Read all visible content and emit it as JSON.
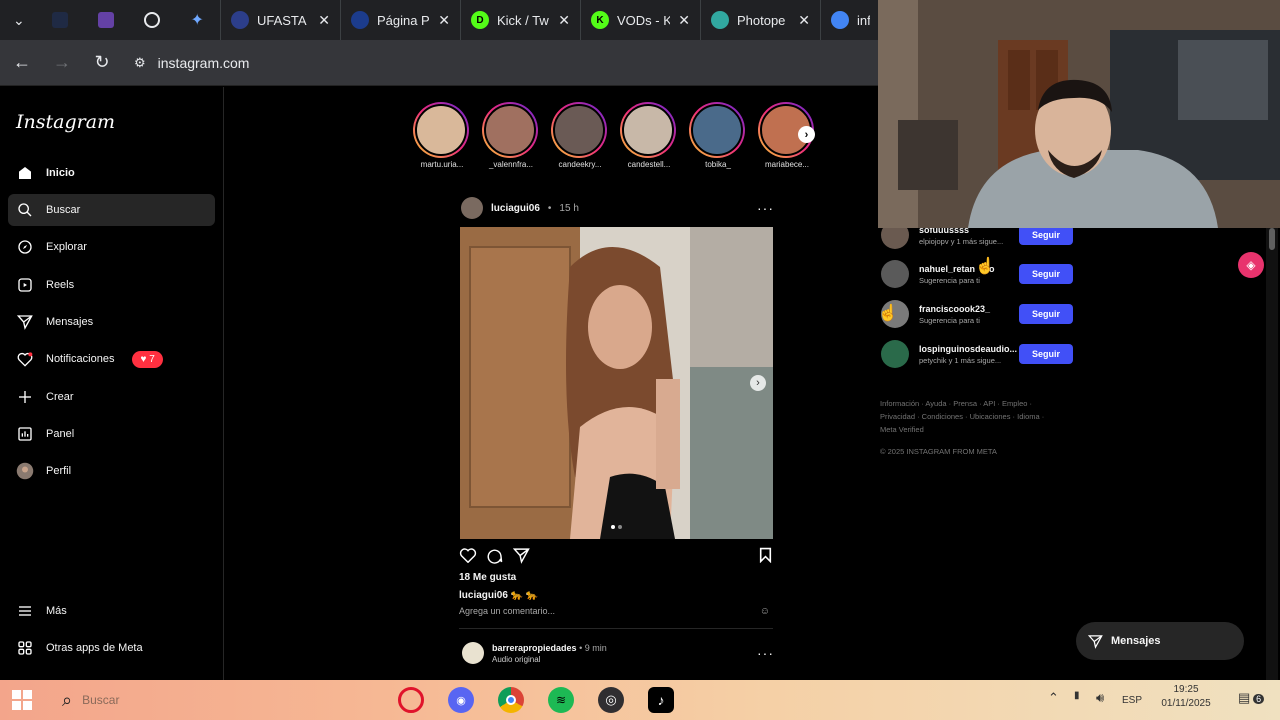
{
  "browser": {
    "tabs": [
      {
        "title": "UFASTA I",
        "fav_color": "#2c3e8a"
      },
      {
        "title": "Página Pr",
        "fav_color": "#1c3c8c"
      },
      {
        "title": "Kick / Tw",
        "fav_color": "#53fc18",
        "fav_letter": "D"
      },
      {
        "title": "VODs - K",
        "fav_color": "#53fc18",
        "fav_letter": "K"
      },
      {
        "title": "Photope",
        "fav_color": "#31a8a0"
      },
      {
        "title": "info",
        "fav_color": "#4285f4"
      }
    ],
    "url": "instagram.com"
  },
  "instagram": {
    "logo": "Instagram",
    "nav": [
      {
        "label": "Inicio",
        "icon": "home-icon"
      },
      {
        "label": "Buscar",
        "icon": "search-icon"
      },
      {
        "label": "Explorar",
        "icon": "explore-icon"
      },
      {
        "label": "Reels",
        "icon": "reels-icon"
      },
      {
        "label": "Mensajes",
        "icon": "messages-icon"
      },
      {
        "label": "Notificaciones",
        "icon": "heart-icon",
        "badge": "7"
      },
      {
        "label": "Crear",
        "icon": "plus-icon"
      },
      {
        "label": "Panel",
        "icon": "chart-icon"
      },
      {
        "label": "Perfil",
        "icon": "avatar-icon"
      }
    ],
    "nav_bottom": [
      {
        "label": "Más",
        "icon": "hamburger-icon"
      },
      {
        "label": "Otras apps de Meta",
        "icon": "meta-icon"
      }
    ],
    "stories": [
      {
        "name": "martu.uria...",
        "color": "#d9b89a"
      },
      {
        "name": "_valennfra...",
        "color": "#a07060"
      },
      {
        "name": "candeekry...",
        "color": "#6a5a55"
      },
      {
        "name": "candestell...",
        "color": "#c8b8a8"
      },
      {
        "name": "tobika_",
        "color": "#4a6a8a"
      },
      {
        "name": "mariabece...",
        "color": "#c07050"
      }
    ],
    "post": {
      "user": "luciagui06",
      "time": "15 h",
      "likes": "18 Me gusta",
      "caption_user": "luciagui06",
      "caption_text": "🐆 🐆",
      "comment_placeholder": "Agrega un comentario..."
    },
    "post2": {
      "user": "barrerapropiedades",
      "time": "9 min",
      "subtitle": "Audio original"
    },
    "suggestions": [
      {
        "user": "sofuuussss",
        "sub": "elpiojopv y 1 más sigue...",
        "color": "#6a5a50"
      },
      {
        "user": "nahuel_retan",
        "user_end": "o",
        "sub": "Sugerencia para ti",
        "color": "#5a5a5a"
      },
      {
        "user": "franciscoook23_",
        "sub": "Sugerencia para ti",
        "color": "#7a7a7a"
      },
      {
        "user": "lospinguinosdeaudio...",
        "sub": "petychik y 1 más sigue...",
        "color": "#2a6a4a"
      }
    ],
    "follow_label": "Seguir",
    "footer_line1": "Información · Ayuda · Prensa · API · Empleo ·",
    "footer_line2": "Privacidad · Condiciones · Ubicaciones · Idioma ·",
    "footer_line3": "Meta Verified",
    "copyright": "© 2025 INSTAGRAM FROM META",
    "messages_pill": "Mensajes"
  },
  "taskbar": {
    "search_placeholder": "Buscar",
    "language": "ESP",
    "time": "19:25",
    "date": "01/11/2025",
    "notifications": "6"
  }
}
